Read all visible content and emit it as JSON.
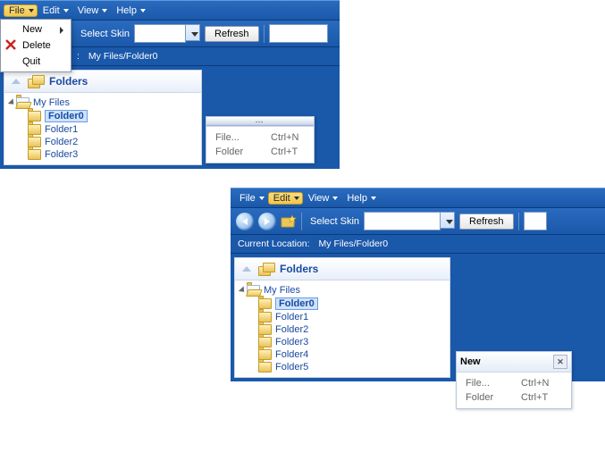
{
  "top": {
    "menubar": {
      "file": "File",
      "edit": "Edit",
      "view": "View",
      "help": "Help"
    },
    "filemenu": {
      "new": "New",
      "delete": "Delete",
      "quit": "Quit"
    },
    "toolbar": {
      "select_skin": "Select Skin",
      "refresh": "Refresh"
    },
    "location": {
      "label": ":",
      "path": "My Files/Folder0"
    },
    "panel_title": "Folders",
    "tree_root": "My Files",
    "tree_items": [
      "Folder0",
      "Folder1",
      "Folder2",
      "Folder3"
    ],
    "floatmenu": {
      "rows": [
        {
          "label": "File...",
          "shortcut": "Ctrl+N"
        },
        {
          "label": "Folder",
          "shortcut": "Ctrl+T"
        }
      ]
    }
  },
  "bottom": {
    "menubar": {
      "file": "File",
      "edit": "Edit",
      "view": "View",
      "help": "Help"
    },
    "toolbar": {
      "select_skin": "Select Skin",
      "refresh": "Refresh"
    },
    "location": {
      "label": "Current Location:",
      "path": "My Files/Folder0"
    },
    "panel_title": "Folders",
    "tree_root": "My Files",
    "tree_items": [
      "Folder0",
      "Folder1",
      "Folder2",
      "Folder3",
      "Folder4",
      "Folder5"
    ],
    "floatmenu": {
      "title": "New",
      "rows": [
        {
          "label": "File...",
          "shortcut": "Ctrl+N"
        },
        {
          "label": "Folder",
          "shortcut": "Ctrl+T"
        }
      ]
    }
  }
}
